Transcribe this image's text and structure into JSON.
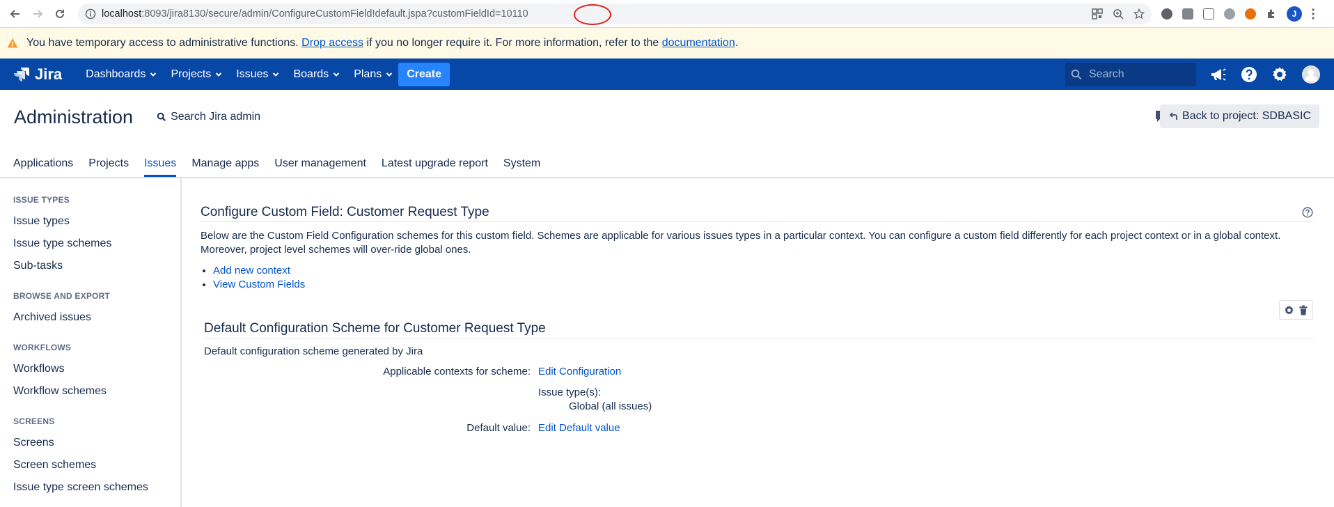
{
  "browser": {
    "url_host": "localhost",
    "url_path": ":8093/jira8130/secure/admin/ConfigureCustomField!default.jspa?customFieldId=10110",
    "profile_initial": "J"
  },
  "banner": {
    "text_before": "You have temporary access to administrative functions.",
    "drop_access_link": "Drop access",
    "text_middle": "if you no longer require it. For more information, refer to the",
    "documentation_link": "documentation",
    "text_after": "."
  },
  "header": {
    "logo_text": "Jira",
    "nav": [
      "Dashboards",
      "Projects",
      "Issues",
      "Boards",
      "Plans"
    ],
    "create_label": "Create",
    "search_placeholder": "Search"
  },
  "admin": {
    "title": "Administration",
    "search_label": "Search Jira admin",
    "back_label": "Back to project: SDBASIC",
    "tabs": [
      "Applications",
      "Projects",
      "Issues",
      "Manage apps",
      "User management",
      "Latest upgrade report",
      "System"
    ],
    "active_tab": "Issues"
  },
  "sidebar": {
    "sections": [
      {
        "heading": "Issue types",
        "items": [
          "Issue types",
          "Issue type schemes",
          "Sub-tasks"
        ]
      },
      {
        "heading": "Browse and export",
        "items": [
          "Archived issues"
        ]
      },
      {
        "heading": "Workflows",
        "items": [
          "Workflows",
          "Workflow schemes"
        ]
      },
      {
        "heading": "Screens",
        "items": [
          "Screens",
          "Screen schemes",
          "Issue type screen schemes"
        ]
      }
    ]
  },
  "main": {
    "title": "Configure Custom Field: Customer Request Type",
    "description": "Below are the Custom Field Configuration schemes for this custom field. Schemes are applicable for various issues types in a particular context. You can configure a custom field differently for each project context or in a global context. Moreover, project level schemes will over-ride global ones.",
    "links": [
      "Add new context",
      "View Custom Fields"
    ],
    "scheme": {
      "title": "Default Configuration Scheme for Customer Request Type",
      "description": "Default configuration scheme generated by Jira",
      "contexts_label": "Applicable contexts for scheme:",
      "edit_configuration": "Edit Configuration",
      "issue_types_label": "Issue type(s):",
      "issue_types_value": "Global (all issues)",
      "default_value_label": "Default value:",
      "edit_default_value": "Edit Default value"
    }
  }
}
